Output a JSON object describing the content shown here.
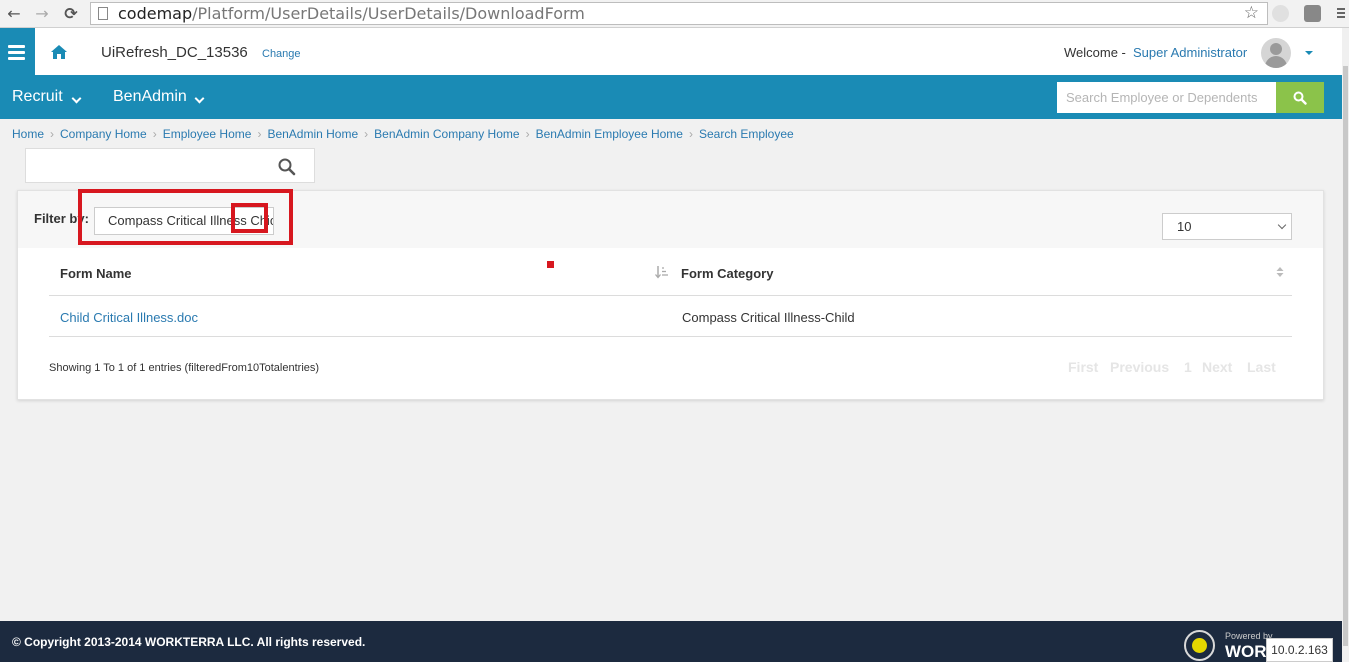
{
  "browser": {
    "url_host": "codemap",
    "url_path": "/Platform/UserDetails/UserDetails/DownloadForm",
    "back_glyph": "←",
    "forward_glyph": "→",
    "reload_glyph": "⟳",
    "star_glyph": "☆"
  },
  "header": {
    "tenant": "UiRefresh_DC_13536",
    "change_label": "Change",
    "welcome_label": "Welcome -",
    "user_name": "Super Administrator"
  },
  "nav": {
    "menus": [
      "Recruit",
      "BenAdmin"
    ],
    "search_placeholder": "Search Employee or Dependents"
  },
  "breadcrumb": [
    "Home",
    "Company Home",
    "Employee Home",
    "BenAdmin Home",
    "BenAdmin Company Home",
    "BenAdmin Employee Home",
    "Search Employee"
  ],
  "filter": {
    "label": "Filter by:",
    "value": "Compass Critical Illness Chic"
  },
  "page_size": "10",
  "table": {
    "columns": [
      "Form Name",
      "Form Category"
    ],
    "rows": [
      {
        "form_name": "Child Critical Illness.doc",
        "form_category": "Compass Critical Illness-Child"
      }
    ],
    "info": "Showing 1 To 1 of 1 entries (filteredFrom10Totalentries)"
  },
  "pager": [
    "First",
    "Previous",
    "1",
    "Next",
    "Last"
  ],
  "footer": {
    "copyright": "© Copyright 2013-2014 WORKTERRA LLC. All rights reserved.",
    "powered_by": "Powered by",
    "brand": "WORKTERRA",
    "version": "10.0.2.163"
  },
  "colors": {
    "primary": "#1a8bb5",
    "search_button": "#8bc34a",
    "footer": "#1c2a3f",
    "highlight": "#d7171f",
    "link": "#2a7ab0"
  }
}
